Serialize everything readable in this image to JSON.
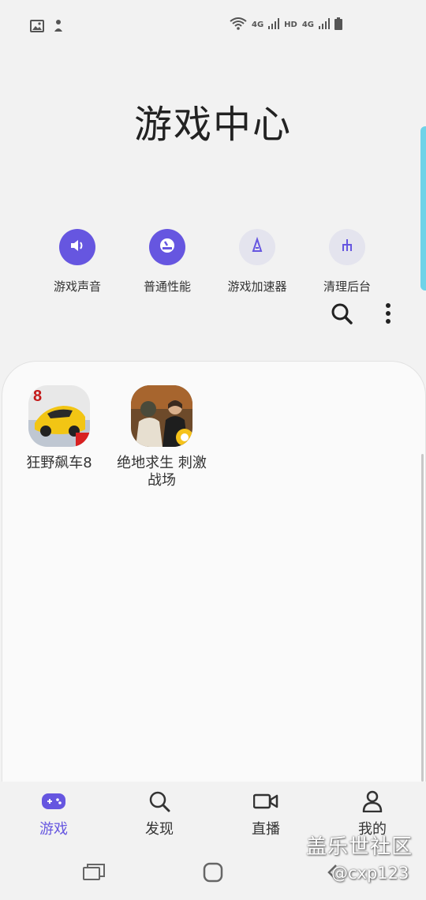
{
  "status_bar": {
    "left_icons": [
      "image-icon",
      "notification-icon"
    ],
    "right_text": [
      "4G",
      "HD",
      "4G"
    ]
  },
  "header": {
    "title": "游戏中心"
  },
  "quick_settings": [
    {
      "label": "游戏声音",
      "icon": "sound-icon",
      "active": true
    },
    {
      "label": "普通性能",
      "icon": "performance-icon",
      "active": true
    },
    {
      "label": "游戏加速器",
      "icon": "booster-icon",
      "active": false
    },
    {
      "label": "清理后台",
      "icon": "clean-icon",
      "active": false
    }
  ],
  "toolbar": {
    "search_icon": "search-icon",
    "more_icon": "more-vert-icon"
  },
  "games": [
    {
      "name": "狂野飙车8"
    },
    {
      "name_line1": "绝地求生 刺激",
      "name_line2": "战场"
    }
  ],
  "bottom_nav": [
    {
      "label": "游戏",
      "icon": "gamepad-icon",
      "active": true
    },
    {
      "label": "发现",
      "icon": "search-icon",
      "active": false
    },
    {
      "label": "直播",
      "icon": "video-icon",
      "active": false
    },
    {
      "label": "我的",
      "icon": "person-icon",
      "active": false
    }
  ],
  "watermark": {
    "line1": "盖乐世社区",
    "line2": "@cxp123"
  },
  "colors": {
    "accent": "#6656e0",
    "handle": "#6fd3e8",
    "background": "#f2f2f2"
  }
}
